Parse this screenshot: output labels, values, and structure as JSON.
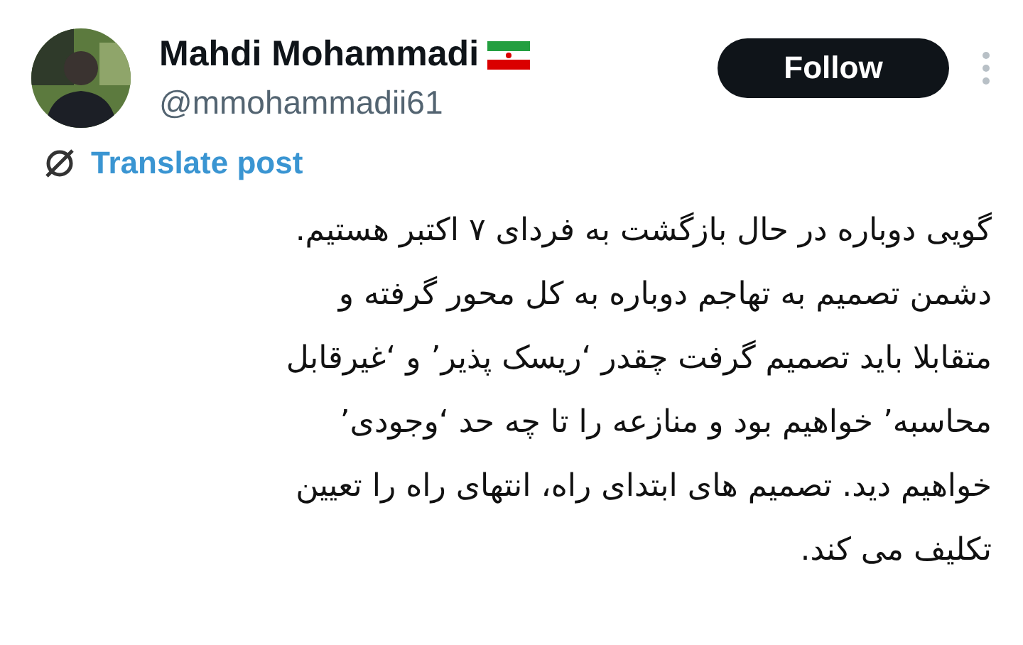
{
  "author": {
    "name": "Mahdi Mohammadi",
    "handle": "@mmohammadii61"
  },
  "follow_button": "Follow",
  "translate_link": "Translate post",
  "post_text": "گویی دوباره در حال بازگشت به فردای ۷ اکتبر هستیم.\nدشمن تصمیم به تهاجم دوباره به کل محور گرفته و\nمتقابلا باید تصمیم گرفت چقدر ‘ریسک پذیر’ و ‘غیرقابل\nمحاسبه’ خواهیم بود و منازعه را تا چه حد ‘وجودی’\nخواهیم دید. تصمیم های ابتدای راه، انتهای راه را تعیین\nتکلیف می کند."
}
